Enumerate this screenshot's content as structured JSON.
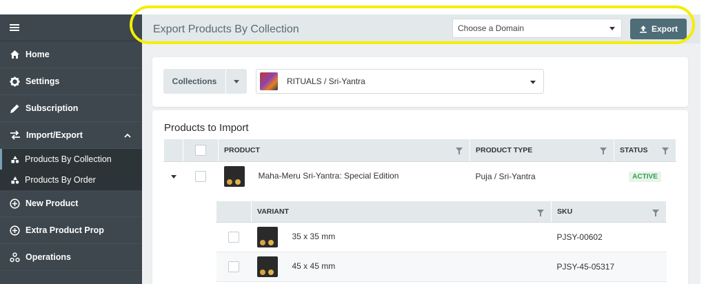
{
  "sidebar": {
    "items": [
      {
        "label": "Home",
        "icon": "home-icon"
      },
      {
        "label": "Settings",
        "icon": "gear-icon"
      },
      {
        "label": "Subscription",
        "icon": "pencil-icon"
      },
      {
        "label": "Import/Export",
        "icon": "swap-arrows-icon"
      },
      {
        "label": "New Product",
        "icon": "plus-circle-icon"
      },
      {
        "label": "Extra Product Prop",
        "icon": "plus-circle-icon"
      },
      {
        "label": "Operations",
        "icon": "cluster-icon"
      }
    ],
    "sub_items": [
      {
        "label": "Products By Collection",
        "icon": "shapes-icon"
      },
      {
        "label": "Products By Order",
        "icon": "shapes-icon"
      }
    ]
  },
  "header": {
    "title": "Export Products By Collection",
    "domain_placeholder": "Choose a Domain",
    "export_label": "Export"
  },
  "filter": {
    "collections_label": "Collections",
    "selected_collection": "RITUALS / Sri-Yantra"
  },
  "products": {
    "section_title": "Products to Import",
    "columns": [
      "PRODUCT",
      "PRODUCT TYPE",
      "STATUS"
    ],
    "rows": [
      {
        "name": "Maha-Meru Sri-Yantra: Special Edition",
        "type": "Puja / Sri-Yantra",
        "status": "ACTIVE"
      }
    ]
  },
  "variants": {
    "columns": [
      "VARIANT",
      "SKU"
    ],
    "rows": [
      {
        "name": "35 x 35 mm",
        "sku": "PJSY-00602"
      },
      {
        "name": "45 x 45 mm",
        "sku": "PJSY-45-05317"
      }
    ]
  },
  "colors": {
    "sidebar_bg": "#3d474d",
    "accent": "#4e6d77",
    "highlight": "#f4ee00",
    "status_active": "#3a9b52"
  }
}
